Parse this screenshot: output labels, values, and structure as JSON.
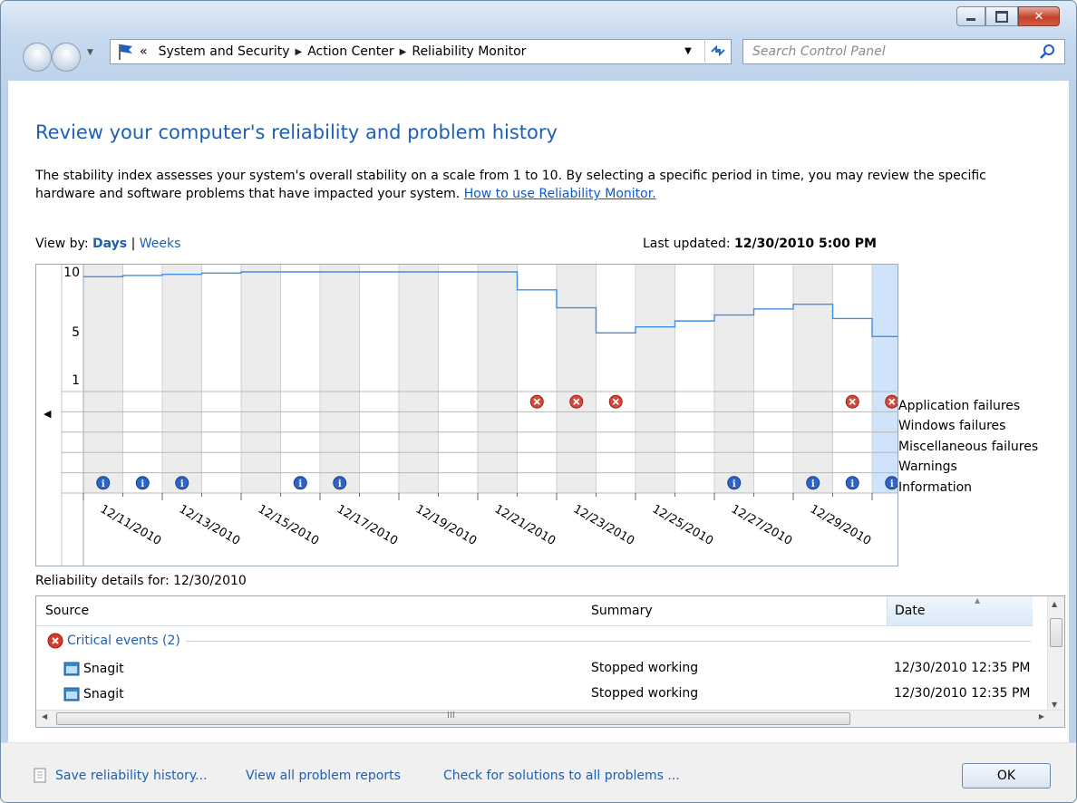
{
  "nav": {
    "breadcrumb_prefix": "«",
    "crumbs": [
      "System and Security",
      "Action Center",
      "Reliability Monitor"
    ],
    "search_placeholder": "Search Control Panel"
  },
  "page": {
    "heading": "Review your computer's reliability and problem history",
    "description": "The stability index assesses your system's overall stability on a scale from 1 to 10. By selecting a specific period in time, you may review the specific hardware and software problems that have impacted your system.",
    "description_link": "How to use Reliability Monitor.",
    "view_by_label": "View by:",
    "view_days": "Days",
    "view_separator": "|",
    "view_weeks": "Weeks",
    "last_updated_label": "Last updated:",
    "last_updated_value": "12/30/2010 5:00 PM"
  },
  "chart_data": {
    "type": "line",
    "y_ticks": [
      "10",
      "5",
      "1"
    ],
    "ylim": [
      0,
      10
    ],
    "x_labels": [
      "12/11/2010",
      "12/13/2010",
      "12/15/2010",
      "12/17/2010",
      "12/19/2010",
      "12/21/2010",
      "12/23/2010",
      "12/25/2010",
      "12/27/2010",
      "12/29/2010"
    ],
    "stability_index": [
      9.6,
      9.7,
      9.8,
      9.9,
      10,
      10,
      10,
      10,
      10,
      10,
      10,
      8.5,
      7.0,
      4.9,
      5.4,
      5.9,
      6.4,
      6.9,
      7.3,
      6.1,
      4.6
    ],
    "row_labels": [
      "Application failures",
      "Windows failures",
      "Miscellaneous failures",
      "Warnings",
      "Information"
    ],
    "application_failure_days": [
      11,
      12,
      13,
      19,
      20
    ],
    "information_days": [
      0,
      1,
      2,
      5,
      6,
      16,
      18,
      19,
      20
    ],
    "selected_day": 20
  },
  "details": {
    "label": "Reliability details for: 12/30/2010",
    "columns": [
      "Source",
      "Summary",
      "Date"
    ],
    "group": "Critical events (2)",
    "rows": [
      {
        "source": "Snagit",
        "summary": "Stopped working",
        "date": "12/30/2010 12:35 PM"
      },
      {
        "source": "Snagit",
        "summary": "Stopped working",
        "date": "12/30/2010 12:35 PM"
      }
    ],
    "hscroll_grip": "III"
  },
  "footer": {
    "save": "Save reliability history...",
    "view_all": "View all problem reports",
    "check": "Check for solutions to all problems ...",
    "ok": "OK"
  }
}
